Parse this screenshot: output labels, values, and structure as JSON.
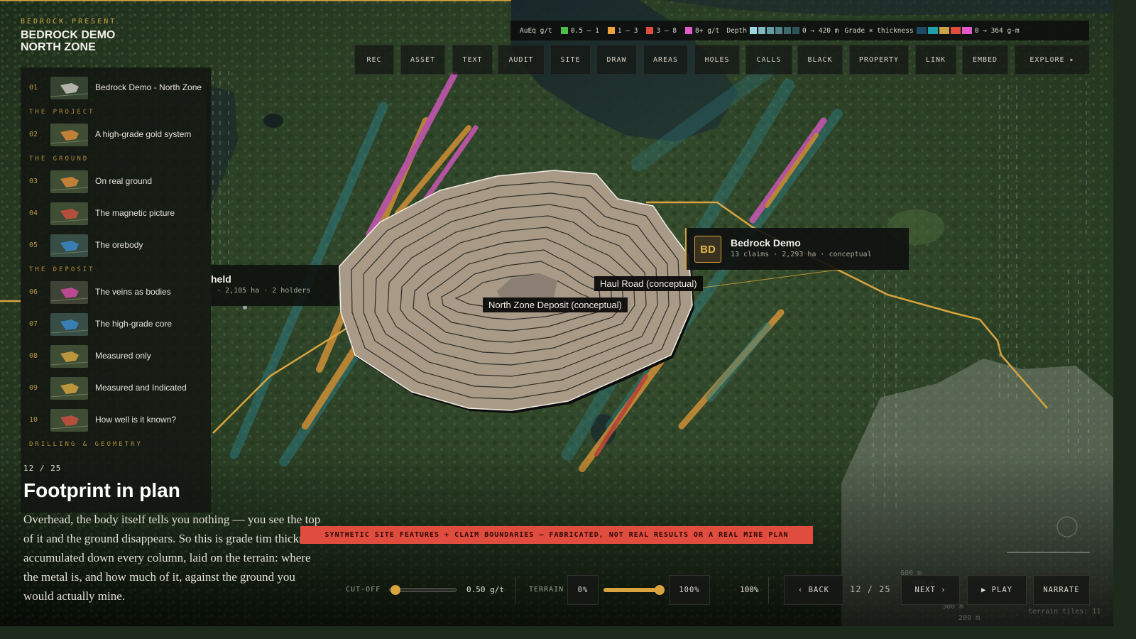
{
  "brand": {
    "sup": "BEDROCK PRESENT",
    "line1": "BEDROCK DEMO",
    "line2": "NORTH ZONE"
  },
  "colors": {
    "accent": "#d1a23d",
    "grade_0_5_1": "#4fbf4a",
    "grade_1_3": "#f0a23a",
    "grade_3_8": "#e04c3d",
    "grade_8_plus": "#e05ac9",
    "warning": "#e04c3d",
    "deposit_fill": "#a89a86"
  },
  "legend": {
    "grade_label": "AuEq g/t",
    "grade_bins": [
      "0.5 – 1",
      "1 – 3",
      "3 – 8",
      "8+ g/t"
    ],
    "depth_label": "Depth",
    "depth_range": "0 → 420 m",
    "gt_label": "Grade × thickness",
    "gt_range": "0 → 364 g·m"
  },
  "toolbar": [
    "REC",
    "ASSET",
    "TEXT",
    "AUDIT",
    "SITE",
    "DRAW",
    "AREAS",
    "HOLES",
    "CALLS",
    "BLACK",
    "PROPERTY",
    "LINK",
    "EMBED",
    "EXPLORE ▸"
  ],
  "sidebar": {
    "items": [
      {
        "type": "item",
        "num": "01",
        "label": "Bedrock Demo - North Zone",
        "thumb": "aerial"
      },
      {
        "type": "section",
        "label": "THE PROJECT"
      },
      {
        "type": "item",
        "num": "02",
        "label": "A high-grade gold system",
        "thumb": "orange"
      },
      {
        "type": "section",
        "label": "THE GROUND"
      },
      {
        "type": "item",
        "num": "03",
        "label": "On real ground",
        "thumb": "orange"
      },
      {
        "type": "item",
        "num": "04",
        "label": "The magnetic picture",
        "thumb": "red"
      },
      {
        "type": "item",
        "num": "05",
        "label": "The orebody",
        "thumb": "blue"
      },
      {
        "type": "section",
        "label": "THE DEPOSIT"
      },
      {
        "type": "item",
        "num": "06",
        "label": "The veins as bodies",
        "thumb": "magenta"
      },
      {
        "type": "item",
        "num": "07",
        "label": "The high-grade core",
        "thumb": "blue"
      },
      {
        "type": "item",
        "num": "08",
        "label": "Measured only",
        "thumb": "gold"
      },
      {
        "type": "item",
        "num": "09",
        "label": "Measured and Indicated",
        "thumb": "gold"
      },
      {
        "type": "item",
        "num": "10",
        "label": "How well is it known?",
        "thumb": "red"
      },
      {
        "type": "section",
        "label": "DRILLING & GEOMETRY"
      }
    ]
  },
  "claim_card": {
    "initials": "BD",
    "name": "Bedrock Demo",
    "meta": "13 claims  ·  2,293 ha  ·  conceptual"
  },
  "held_card": {
    "name": "held",
    "meta": "· 2,105 ha  ·  2 holders"
  },
  "labels": {
    "deposit": "North Zone Deposit (conceptual)",
    "haul_road": "Haul Road (conceptual)"
  },
  "slide": {
    "counter": "12 / 25",
    "title": "Footprint in plan",
    "body": "Overhead, the body itself tells you nothing — you see the top of it and the ground disappears. So this is grade tim thickness accumulated down every column, laid on the terrain: where the metal is, and how much of it, against the ground you would actually mine."
  },
  "warning": "SYNTHETIC SITE FEATURES + CLAIM BOUNDARIES — FABRICATED, NOT REAL RESULTS OR A REAL MINE PLAN",
  "controls": {
    "cutoff_label": "CUT-OFF",
    "cutoff_value": "0.50 g/t",
    "cutoff_fraction": 0.02,
    "terrain_label": "TERRAIN",
    "terrain_min": "0%",
    "terrain_max": "100%",
    "terrain_fraction": 1.0,
    "zoom": "100%",
    "back": "‹ BACK",
    "pager": "12 / 25",
    "next": "NEXT ›",
    "play": "▶ PLAY",
    "narrate": "NARRATE"
  }
}
